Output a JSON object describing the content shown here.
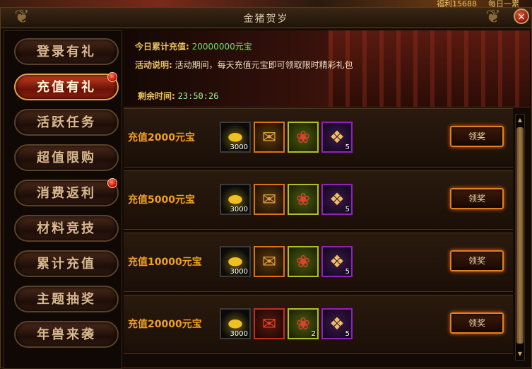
{
  "top_info": {
    "welfare": "福利15688",
    "daily": "每日一累"
  },
  "window": {
    "title": "金猪贺岁"
  },
  "sidebar": {
    "items": [
      {
        "label": "登录有礼",
        "active": false,
        "badge": false
      },
      {
        "label": "充值有礼",
        "active": true,
        "badge": true
      },
      {
        "label": "活跃任务",
        "active": false,
        "badge": false
      },
      {
        "label": "超值限购",
        "active": false,
        "badge": false
      },
      {
        "label": "消费返利",
        "active": false,
        "badge": true
      },
      {
        "label": "材料竞技",
        "active": false,
        "badge": false
      },
      {
        "label": "累计充值",
        "active": false,
        "badge": false
      },
      {
        "label": "主题抽奖",
        "active": false,
        "badge": false
      },
      {
        "label": "年兽来袭",
        "active": false,
        "badge": false
      }
    ]
  },
  "banner": {
    "total_recharge_label": "今日累计充值:",
    "total_recharge_value": "20000000元宝",
    "desc_label": "活动说明:",
    "desc_text": "活动期间，每天充值元宝即可领取限时精彩礼包",
    "remaining_label": "剩余时间:",
    "remaining_value": "23:50:26"
  },
  "rewards": [
    {
      "label": "充值2000元宝",
      "items": [
        {
          "icon": "gold-ingot-icon",
          "frame": "gold",
          "count": "3000"
        },
        {
          "icon": "scroll-icon",
          "frame": "orange",
          "count": ""
        },
        {
          "icon": "red-pouch-icon",
          "frame": "green",
          "count": ""
        },
        {
          "icon": "yellow-pouch-icon",
          "frame": "purple",
          "count": "5"
        }
      ],
      "button": "领奖"
    },
    {
      "label": "充值5000元宝",
      "items": [
        {
          "icon": "gold-ingot-icon",
          "frame": "gold",
          "count": "3000"
        },
        {
          "icon": "scroll-icon",
          "frame": "orange",
          "count": ""
        },
        {
          "icon": "red-pouch-icon",
          "frame": "green",
          "count": ""
        },
        {
          "icon": "yellow-pouch-icon",
          "frame": "purple",
          "count": "5"
        }
      ],
      "button": "领奖"
    },
    {
      "label": "充值10000元宝",
      "items": [
        {
          "icon": "gold-ingot-icon",
          "frame": "gold",
          "count": "3000"
        },
        {
          "icon": "scroll-icon",
          "frame": "orange",
          "count": ""
        },
        {
          "icon": "red-pouch-icon",
          "frame": "green",
          "count": ""
        },
        {
          "icon": "yellow-pouch-icon",
          "frame": "purple",
          "count": "5"
        }
      ],
      "button": "领奖"
    },
    {
      "label": "充值20000元宝",
      "items": [
        {
          "icon": "gold-ingot-icon",
          "frame": "gold",
          "count": "3000"
        },
        {
          "icon": "red-scroll-icon",
          "frame": "red",
          "count": ""
        },
        {
          "icon": "red-pouch-icon",
          "frame": "green",
          "count": "2"
        },
        {
          "icon": "yellow-pouch-icon",
          "frame": "purple",
          "count": "5"
        }
      ],
      "button": "领奖"
    }
  ],
  "close_label": "×",
  "colors": {
    "accent": "#e08020",
    "label": "#f0a020",
    "highlight": "#70e060"
  }
}
